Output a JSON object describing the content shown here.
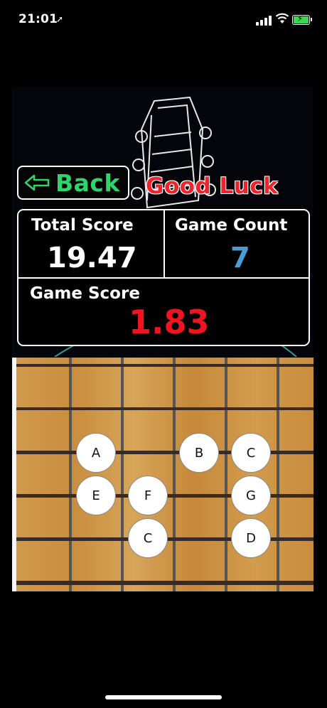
{
  "status_bar": {
    "time": "21:01"
  },
  "header": {
    "back_label": "Back",
    "good_luck": "Good Luck"
  },
  "scores": {
    "total_score_label": "Total Score",
    "total_score_value": "19.47",
    "game_count_label": "Game Count",
    "game_count_value": "7",
    "game_score_label": "Game Score",
    "game_score_value": "1.83"
  },
  "fretboard": {
    "notes": [
      "A",
      "B",
      "C",
      "E",
      "F",
      "G",
      "C",
      "D"
    ]
  }
}
